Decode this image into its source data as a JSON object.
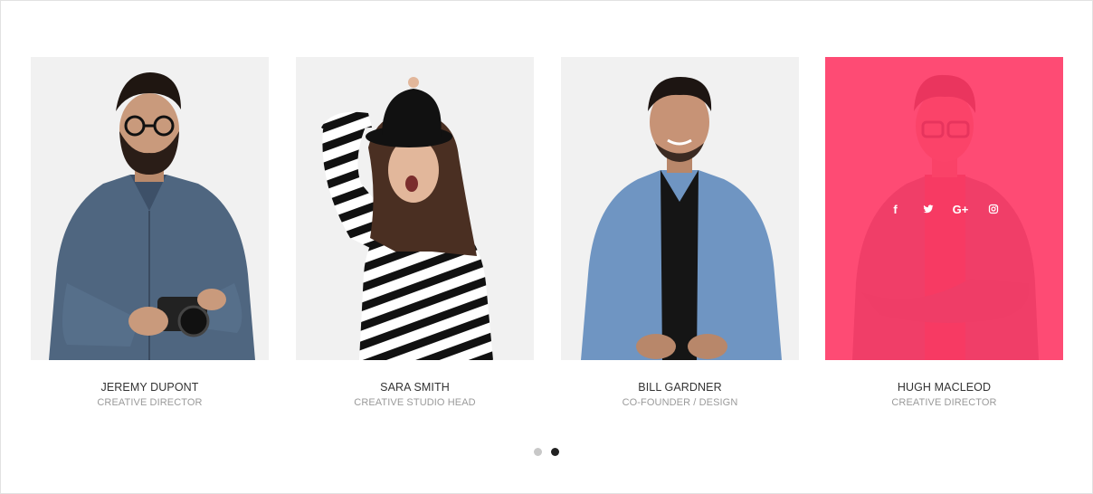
{
  "team": [
    {
      "name": "JEREMY DUPONT",
      "role": "CREATIVE DIRECTOR"
    },
    {
      "name": "SARA SMITH",
      "role": "CREATIVE STUDIO HEAD"
    },
    {
      "name": "BILL GARDNER",
      "role": "CO-FOUNDER / DESIGN"
    },
    {
      "name": "HUGH MACLEOD",
      "role": "CREATIVE DIRECTOR"
    }
  ],
  "social": [
    "facebook-icon",
    "twitter-icon",
    "google-plus-icon",
    "instagram-icon"
  ],
  "social_labels": {
    "facebook": "f",
    "google_plus": "G+"
  },
  "colors": {
    "accent": "#FF3866",
    "card_bg": "#F1F1F1",
    "name": "#333333",
    "role": "#9A9A9A"
  },
  "pagination": {
    "pages": 2,
    "active": 2
  }
}
